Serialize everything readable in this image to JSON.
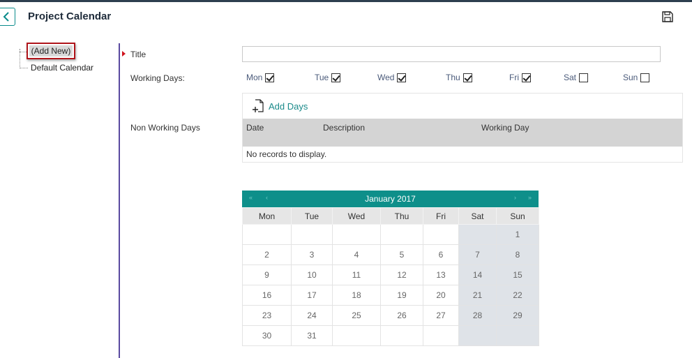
{
  "header": {
    "title": "Project Calendar"
  },
  "tree": {
    "items": [
      "(Add New)",
      "Default Calendar"
    ]
  },
  "form": {
    "title_label": "Title",
    "title_value": "",
    "working_days_label": "Working Days:",
    "days": [
      {
        "label": "Mon",
        "checked": true
      },
      {
        "label": "Tue",
        "checked": true
      },
      {
        "label": "Wed",
        "checked": true
      },
      {
        "label": "Thu",
        "checked": true
      },
      {
        "label": "Fri",
        "checked": true
      },
      {
        "label": "Sat",
        "checked": false
      },
      {
        "label": "Sun",
        "checked": false
      }
    ],
    "non_working_label": "Non Working Days"
  },
  "grid": {
    "add_days": "Add Days",
    "columns": [
      "Date",
      "Description",
      "Working Day"
    ],
    "empty_text": "No records to display."
  },
  "calendar": {
    "month": "January 2017",
    "nav": {
      "first": "«",
      "prev": "‹",
      "next": "›",
      "last": "»"
    },
    "weekdays": [
      "Mon",
      "Tue",
      "Wed",
      "Thu",
      "Fri",
      "Sat",
      "Sun"
    ],
    "weeks": [
      [
        "",
        "",
        "",
        "",
        "",
        "",
        "1"
      ],
      [
        "2",
        "3",
        "4",
        "5",
        "6",
        "7",
        "8"
      ],
      [
        "9",
        "10",
        "11",
        "12",
        "13",
        "14",
        "15"
      ],
      [
        "16",
        "17",
        "18",
        "19",
        "20",
        "21",
        "22"
      ],
      [
        "23",
        "24",
        "25",
        "26",
        "27",
        "28",
        "29"
      ],
      [
        "30",
        "31",
        "",
        "",
        "",
        "",
        ""
      ]
    ]
  },
  "colors": {
    "accent": "#0e8f8a",
    "required": "#d0141e",
    "divider": "#5a4aa0"
  }
}
